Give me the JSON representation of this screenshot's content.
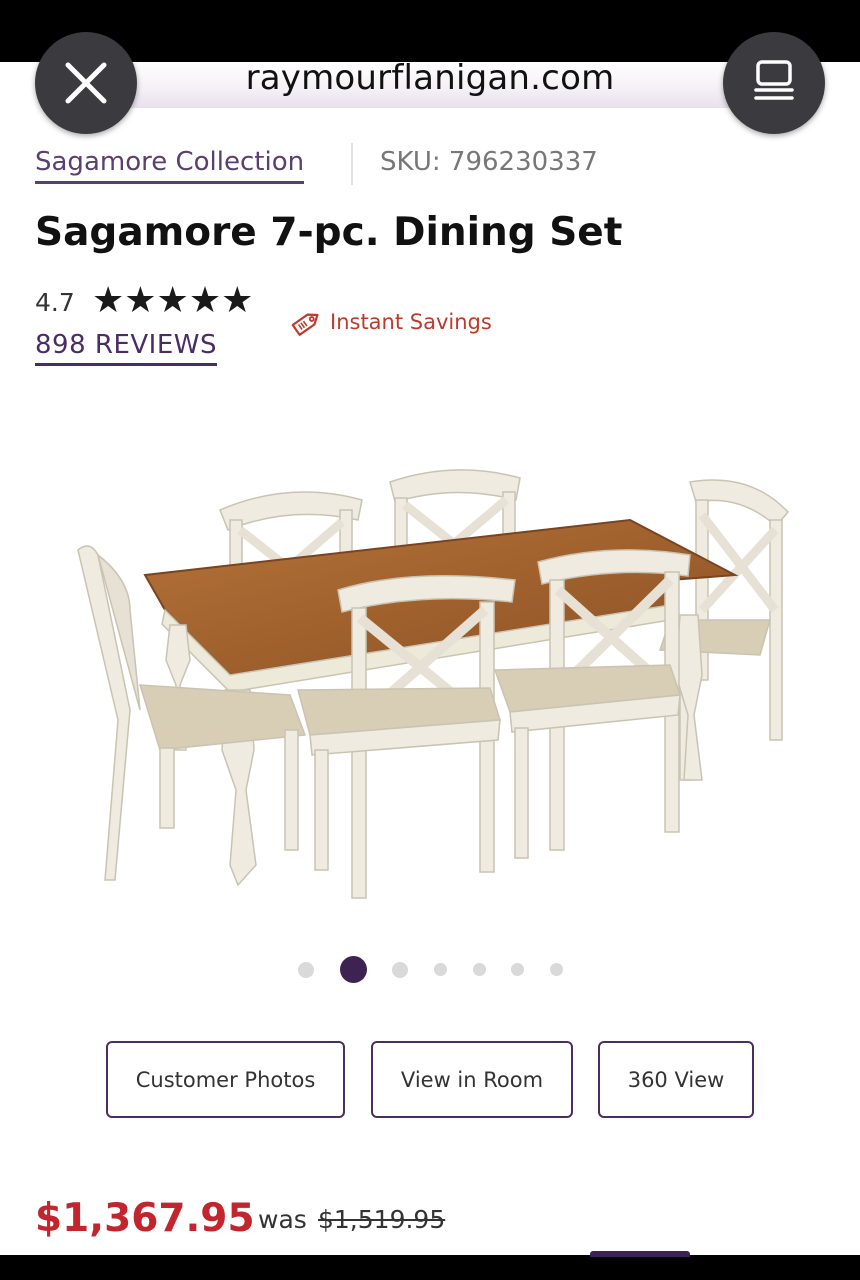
{
  "browser": {
    "url": "raymourflanigan.com",
    "close_icon": "close-icon",
    "tabs_icon": "tabs-icon"
  },
  "breadcrumb": {
    "collection": "Sagamore Collection",
    "sku": "SKU: 796230337"
  },
  "product": {
    "title": "Sagamore 7-pc. Dining Set",
    "rating": "4.7",
    "stars": "★★★★★",
    "rating_value": 4.7,
    "reviews_label": "898 REVIEWS",
    "savings_label": "Instant Savings",
    "image_icon": "dining-set-image"
  },
  "carousel": {
    "total_dots": 7,
    "active_index": 1
  },
  "actions": {
    "customer_photos": "Customer Photos",
    "view_in_room": "View in Room",
    "view_360": "360 View"
  },
  "pricing": {
    "current": "$1,367.95",
    "was_label": "was",
    "was_price": "$1,519.95"
  },
  "colors": {
    "brand_purple": "#4a2d63",
    "sale_red": "#c2252e",
    "savings_red": "#c0392b"
  }
}
